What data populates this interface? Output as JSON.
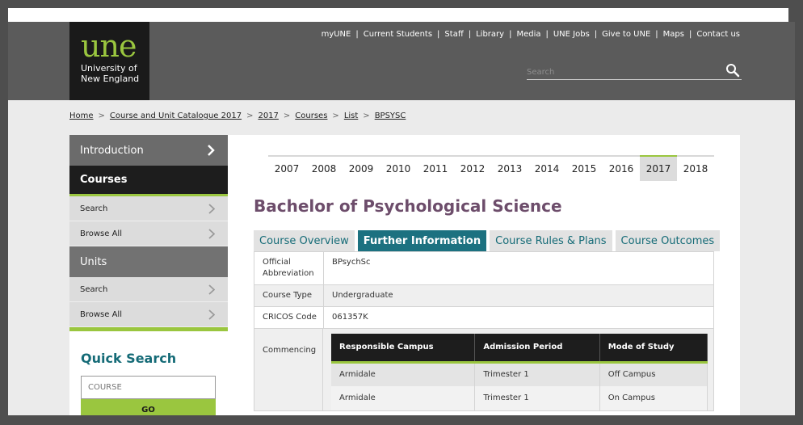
{
  "logo": {
    "mark": "une",
    "line1": "University of",
    "line2": "New England"
  },
  "top_links": [
    "myUNE",
    "Current Students",
    "Staff",
    "Library",
    "Media",
    "UNE Jobs",
    "Give to UNE",
    "Maps",
    "Contact us"
  ],
  "search": {
    "placeholder": "Search"
  },
  "breadcrumb": [
    "Home",
    "Course and Unit Catalogue 2017",
    "2017",
    "Courses",
    "List",
    "BPSYSC"
  ],
  "sidebar": {
    "introduction": "Introduction",
    "courses": "Courses",
    "courses_search": "Search",
    "courses_browse": "Browse All",
    "units": "Units",
    "units_search": "Search",
    "units_browse": "Browse All",
    "quick_search_title": "Quick Search",
    "quick_search_placeholder": "COURSE",
    "go_label": "GO"
  },
  "years": [
    "2007",
    "2008",
    "2009",
    "2010",
    "2011",
    "2012",
    "2013",
    "2014",
    "2015",
    "2016",
    "2017",
    "2018"
  ],
  "active_year": "2017",
  "course_title": "Bachelor of Psychological Science",
  "tabs": [
    "Course Overview",
    "Further Information",
    "Course Rules & Plans",
    "Course Outcomes"
  ],
  "active_tab": "Further Information",
  "info": {
    "abbr_label_1": "Official",
    "abbr_label_2": "Abbreviation",
    "abbr_value": "BPsychSc",
    "type_label": "Course Type",
    "type_value": "Undergraduate",
    "cricos_label": "CRICOS Code",
    "cricos_value": "061357K",
    "commencing_label": "Commencing"
  },
  "commencing_table": {
    "headers": [
      "Responsible Campus",
      "Admission Period",
      "Mode of Study"
    ],
    "rows": [
      [
        "Armidale",
        "Trimester 1",
        "Off Campus"
      ],
      [
        "Armidale",
        "Trimester 1",
        "On Campus"
      ]
    ]
  },
  "colors": {
    "brand_green": "#9ac63f",
    "teal": "#1c7180",
    "title_purple": "#6d4d6b",
    "header_grey": "#5b5b5b"
  }
}
